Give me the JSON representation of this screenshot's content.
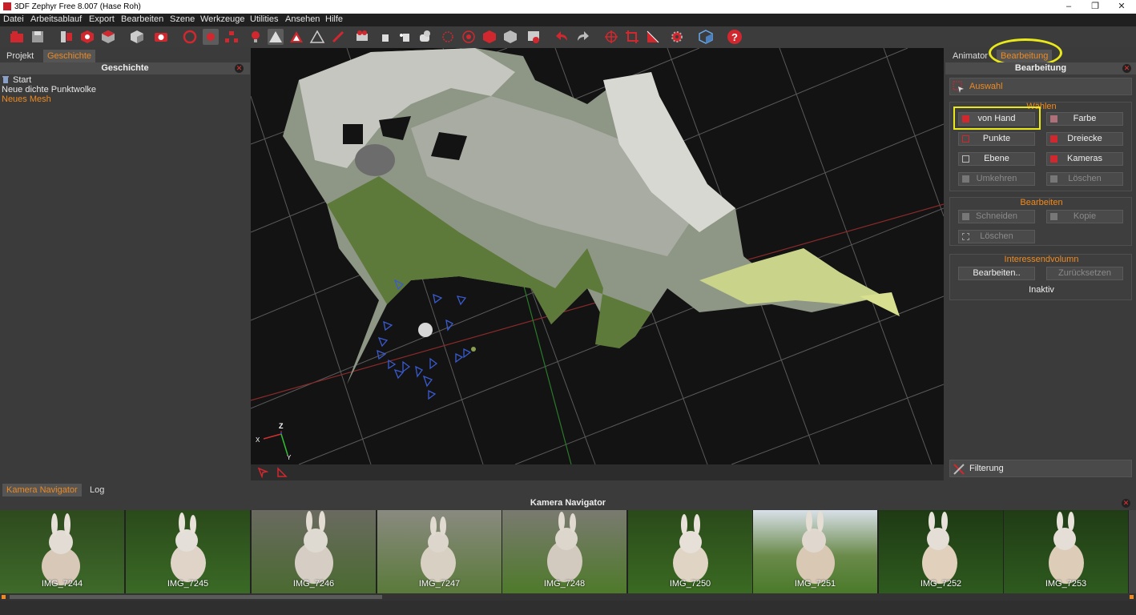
{
  "window": {
    "title": "3DF Zephyr Free 8.007 (Hase Roh)",
    "controls": [
      "–",
      "❐",
      "✕"
    ]
  },
  "menu": [
    "Datei",
    "Arbeitsablauf",
    "Export",
    "Bearbeiten",
    "Szene",
    "Werkzeuge",
    "Utilities",
    "Ansehen",
    "Hilfe"
  ],
  "toolbar_icons": [
    "new-project-icon",
    "save-icon",
    "workflow-icon",
    "dense-cloud-icon",
    "mesh-icon",
    "textured-mesh-icon",
    "camera-icon",
    "rotate-icon",
    "record-icon",
    "hierarchy-icon",
    "light-icon",
    "solid-icon",
    "wireframe-icon",
    "points-icon",
    "brush-icon",
    "video-icon",
    "hand-icon",
    "pick-icon",
    "shape-icon",
    "sphere-grid-icon",
    "target-icon",
    "cube-red-icon",
    "cube-grey-icon",
    "screenshot-icon",
    "undo-icon",
    "redo-icon",
    "orbit-icon",
    "crop-icon",
    "ruler-icon",
    "settings-icon",
    "box-icon",
    "help-icon"
  ],
  "left_panel": {
    "tabs": [
      "Projekt",
      "Geschichte"
    ],
    "active_tab": "Geschichte",
    "title": "Geschichte",
    "history": [
      "Start",
      "Neue dichte Punktwolke",
      "Neues Mesh"
    ]
  },
  "viewport": {
    "axis_labels": {
      "z": "Z",
      "x": "X",
      "y": "Y"
    }
  },
  "right_panel": {
    "tabs": [
      "Animator",
      "Bearbeitung"
    ],
    "active_tab": "Bearbeitung",
    "title": "Bearbeitung",
    "auswahl_label": "Auswahl",
    "waehlen": {
      "title": "Wählen",
      "buttons": [
        "von Hand",
        "Farbe",
        "Punkte",
        "Dreiecke",
        "Ebene",
        "Kameras",
        "Umkehren",
        "Löschen"
      ]
    },
    "bearbeiten": {
      "title": "Bearbeiten",
      "buttons": [
        "Schneiden",
        "Kopie",
        "Löschen"
      ]
    },
    "interesse": {
      "title": "Interessendvolumn",
      "buttons": [
        "Bearbeiten..",
        "Zurücksetzen"
      ],
      "status": "Inaktiv"
    },
    "filter_label": "Filterung"
  },
  "bottom": {
    "tabs": [
      "Kamera Navigator",
      "Log"
    ],
    "active_tab": "Kamera Navigator",
    "title": "Kamera Navigator",
    "thumbnails": [
      "IMG_7244",
      "IMG_7245",
      "IMG_7246",
      "IMG_7247",
      "IMG_7248",
      "IMG_7250",
      "IMG_7251",
      "IMG_7252",
      "IMG_7253"
    ]
  },
  "colors": {
    "accent": "#f08a1e",
    "highlight": "#e8e81a",
    "toolbar_red": "#d0282e"
  }
}
